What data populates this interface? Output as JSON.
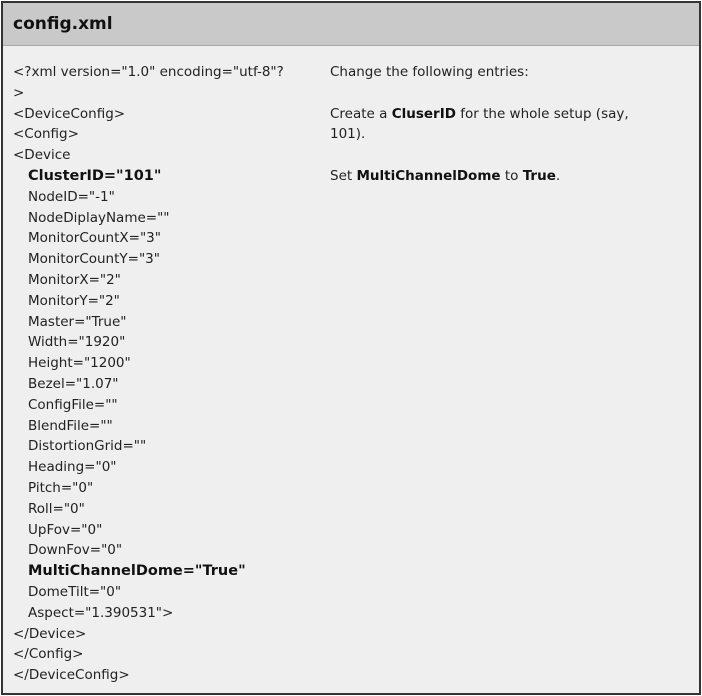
{
  "header": {
    "title": "config.xml"
  },
  "code": {
    "lines": [
      {
        "text": "<?xml version=\"1.0\" encoding=\"utf-8\"?",
        "indent": false,
        "bold": false
      },
      {
        "text": ">",
        "indent": false,
        "bold": false
      },
      {
        "text": "<DeviceConfig>",
        "indent": false,
        "bold": false
      },
      {
        "text": "<Config>",
        "indent": false,
        "bold": false
      },
      {
        "text": "<Device",
        "indent": false,
        "bold": false
      },
      {
        "text": "ClusterID=\"101\"",
        "indent": true,
        "bold": true
      },
      {
        "text": "NodeID=\"-1\"",
        "indent": true,
        "bold": false
      },
      {
        "text": "NodeDiplayName=\"\"",
        "indent": true,
        "bold": false
      },
      {
        "text": "MonitorCountX=\"3\"",
        "indent": true,
        "bold": false
      },
      {
        "text": "MonitorCountY=\"3\"",
        "indent": true,
        "bold": false
      },
      {
        "text": "MonitorX=\"2\"",
        "indent": true,
        "bold": false
      },
      {
        "text": "MonitorY=\"2\"",
        "indent": true,
        "bold": false
      },
      {
        "text": "Master=\"True\"",
        "indent": true,
        "bold": false
      },
      {
        "text": "Width=\"1920\"",
        "indent": true,
        "bold": false
      },
      {
        "text": "Height=\"1200\"",
        "indent": true,
        "bold": false
      },
      {
        "text": "Bezel=\"1.07\"",
        "indent": true,
        "bold": false
      },
      {
        "text": "ConfigFile=\"\"",
        "indent": true,
        "bold": false
      },
      {
        "text": "BlendFile=\"\"",
        "indent": true,
        "bold": false
      },
      {
        "text": "DistortionGrid=\"\"",
        "indent": true,
        "bold": false
      },
      {
        "text": "Heading=\"0\"",
        "indent": true,
        "bold": false
      },
      {
        "text": "Pitch=\"0\"",
        "indent": true,
        "bold": false
      },
      {
        "text": "Roll=\"0\"",
        "indent": true,
        "bold": false
      },
      {
        "text": "UpFov=\"0\"",
        "indent": true,
        "bold": false
      },
      {
        "text": "DownFov=\"0\"",
        "indent": true,
        "bold": false
      },
      {
        "text": "MultiChannelDome=\"True\"",
        "indent": true,
        "bold": true
      },
      {
        "text": "DomeTilt=\"0\"",
        "indent": true,
        "bold": false
      },
      {
        "text": "Aspect=\"1.390531\">",
        "indent": true,
        "bold": false
      },
      {
        "text": "</Device>",
        "indent": false,
        "bold": false
      },
      {
        "text": "</Config>",
        "indent": false,
        "bold": false
      },
      {
        "text": "</DeviceConfig>",
        "indent": false,
        "bold": false
      }
    ]
  },
  "notes": {
    "intro": "Change the following entries:",
    "cluster_pre": "Create a ",
    "cluster_bold": "CluserID",
    "cluster_post": " for the whole setup (say,",
    "cluster_line2": "101).",
    "dome_pre": "Set ",
    "dome_bold": "MultiChannelDome",
    "dome_mid": " to ",
    "dome_value": "True",
    "dome_post": "."
  }
}
